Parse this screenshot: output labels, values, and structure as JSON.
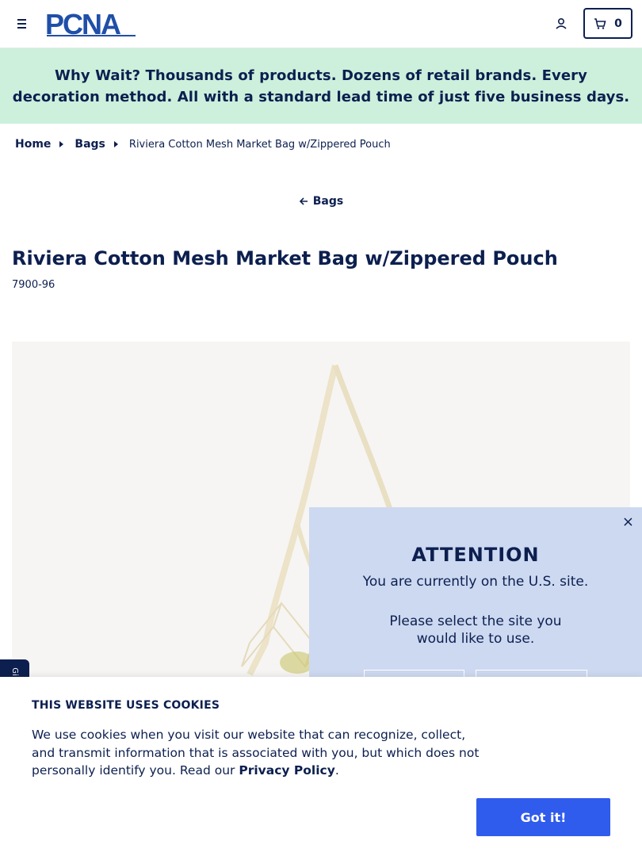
{
  "header": {
    "logo_text": "PCNA",
    "cart_count": "0"
  },
  "promo": {
    "lead": "Why Wait?",
    "text": " Thousands of products. Dozens of retail brands. Every decoration method. All with a standard lead time of just five business days."
  },
  "breadcrumb": {
    "items": [
      "Home",
      "Bags"
    ],
    "current": "Riviera Cotton Mesh Market Bag w/Zippered Pouch"
  },
  "back_link": "Bags",
  "product": {
    "title": "Riviera Cotton Mesh Market Bag w/Zippered Pouch",
    "sku": "7900-96"
  },
  "side_tab": "Gi",
  "modal": {
    "close": "×",
    "heading": "ATTENTION",
    "line1": "You are currently on the U.S. site.",
    "line2": "Please select the site you would like to use."
  },
  "cookie": {
    "heading": "THIS WEBSITE USES COOKIES",
    "body": "We use cookies when you visit our website that can recognize, collect, and transmit information that is associated with you, but which does not personally identify you. Read our ",
    "link": "Privacy Policy",
    "end": ".",
    "button": "Got it!"
  },
  "colors": {
    "navy": "#0c1f4f",
    "promo_bg": "#ccf0dc",
    "modal_bg": "#cdd9f1",
    "button_blue": "#2f5cec"
  }
}
